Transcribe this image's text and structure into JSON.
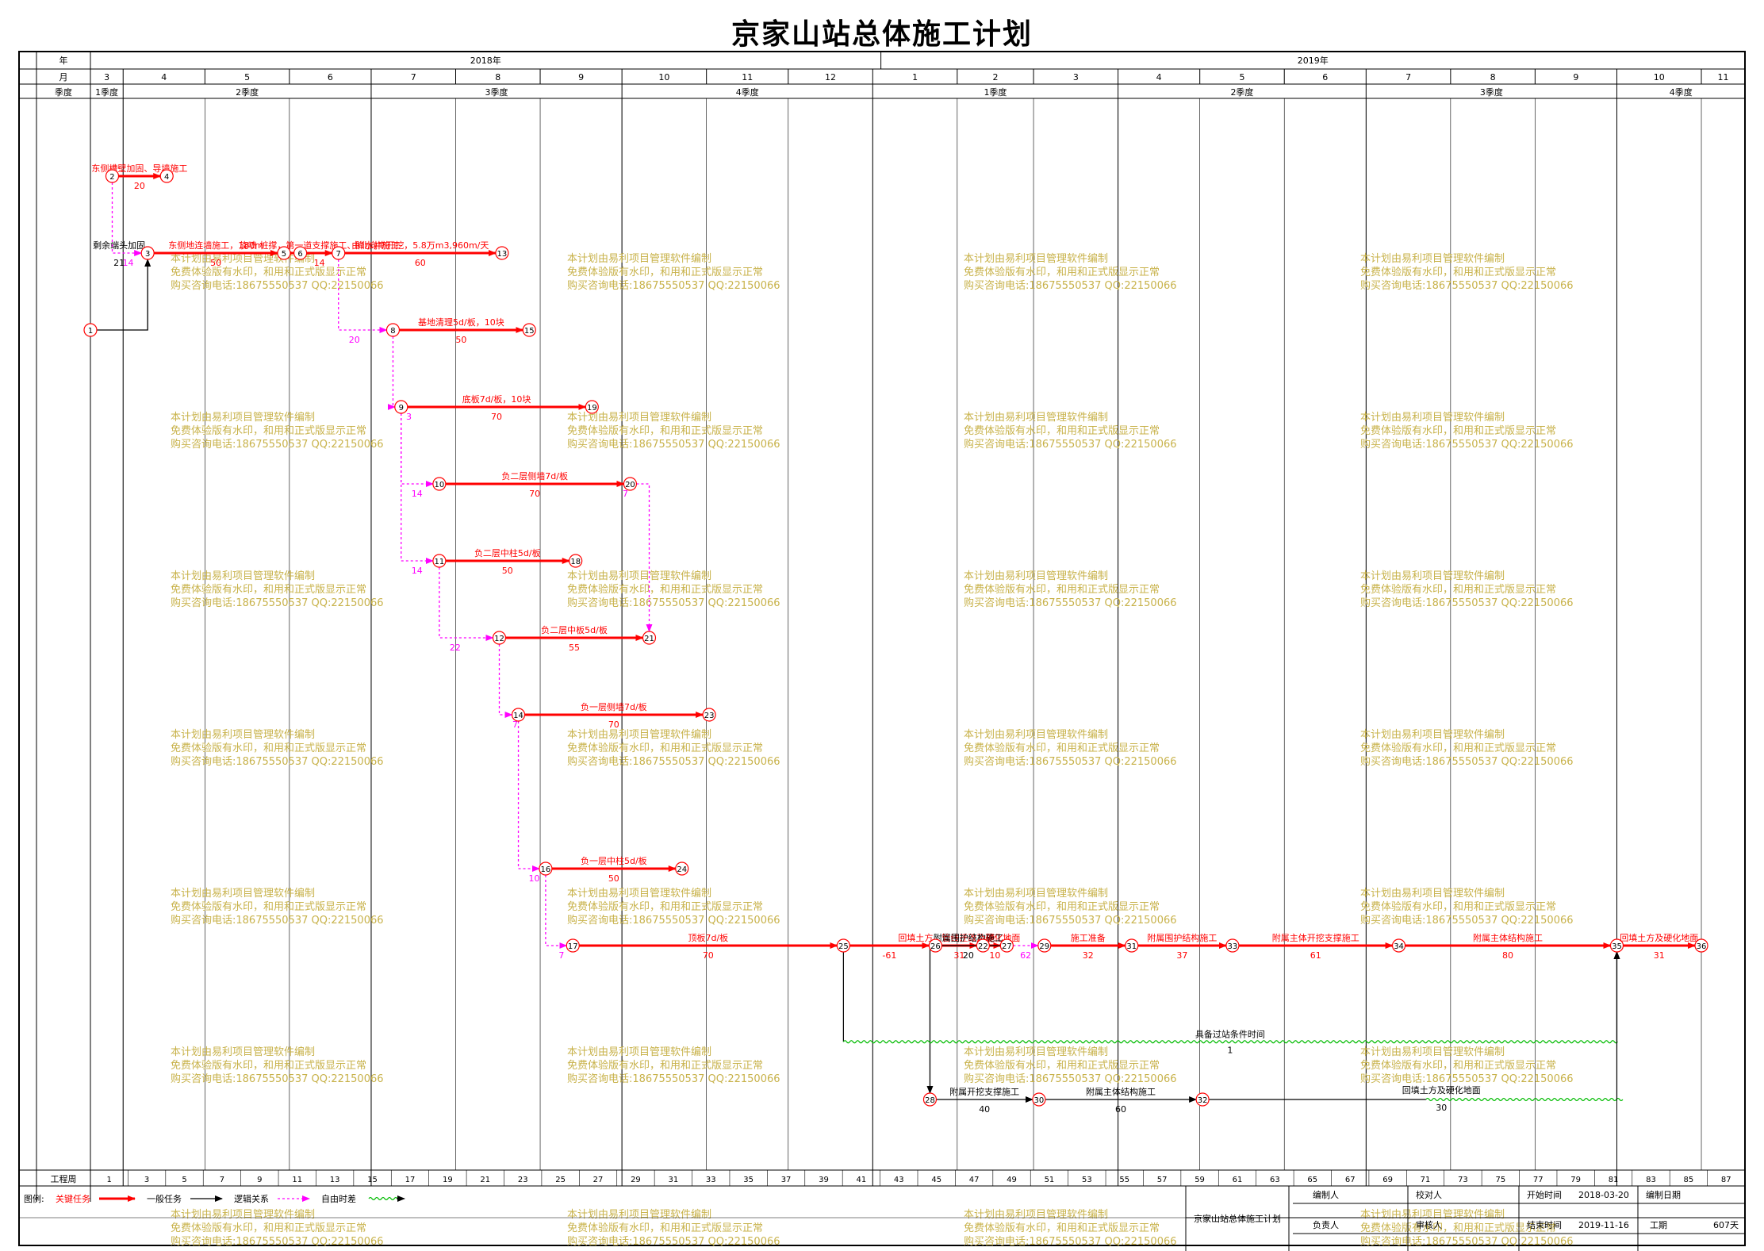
{
  "title": "京家山站总体施工计划",
  "header_labels": {
    "year": "年",
    "month": "月",
    "quarter": "季度",
    "week": "工程周"
  },
  "years": [
    {
      "label": "2018年",
      "start": 0,
      "end": 290
    },
    {
      "label": "2019年",
      "start": 290,
      "end": 607
    }
  ],
  "months": [
    {
      "label": "3",
      "start": 0,
      "end": 12
    },
    {
      "label": "4",
      "start": 12,
      "end": 42
    },
    {
      "label": "5",
      "start": 42,
      "end": 73
    },
    {
      "label": "6",
      "start": 73,
      "end": 103
    },
    {
      "label": "7",
      "start": 103,
      "end": 134
    },
    {
      "label": "8",
      "start": 134,
      "end": 165
    },
    {
      "label": "9",
      "start": 165,
      "end": 195
    },
    {
      "label": "10",
      "start": 195,
      "end": 226
    },
    {
      "label": "11",
      "start": 226,
      "end": 256
    },
    {
      "label": "12",
      "start": 256,
      "end": 287
    },
    {
      "label": "1",
      "start": 287,
      "end": 318
    },
    {
      "label": "2",
      "start": 318,
      "end": 346
    },
    {
      "label": "3",
      "start": 346,
      "end": 377
    },
    {
      "label": "4",
      "start": 377,
      "end": 407
    },
    {
      "label": "5",
      "start": 407,
      "end": 438
    },
    {
      "label": "6",
      "start": 438,
      "end": 468
    },
    {
      "label": "7",
      "start": 468,
      "end": 499
    },
    {
      "label": "8",
      "start": 499,
      "end": 530
    },
    {
      "label": "9",
      "start": 530,
      "end": 560
    },
    {
      "label": "10",
      "start": 560,
      "end": 591
    },
    {
      "label": "11",
      "start": 591,
      "end": 607
    }
  ],
  "quarters": [
    {
      "label": "1季度",
      "start": 0,
      "end": 12
    },
    {
      "label": "2季度",
      "start": 12,
      "end": 103
    },
    {
      "label": "3季度",
      "start": 103,
      "end": 195
    },
    {
      "label": "4季度",
      "start": 195,
      "end": 287
    },
    {
      "label": "1季度",
      "start": 287,
      "end": 377
    },
    {
      "label": "2季度",
      "start": 377,
      "end": 468
    },
    {
      "label": "3季度",
      "start": 468,
      "end": 560
    },
    {
      "label": "4季度",
      "start": 560,
      "end": 607
    }
  ],
  "weeks": [
    "1",
    "3",
    "5",
    "7",
    "9",
    "11",
    "13",
    "15",
    "17",
    "19",
    "21",
    "23",
    "25",
    "27",
    "29",
    "31",
    "33",
    "35",
    "37",
    "39",
    "41",
    "43",
    "45",
    "47",
    "49",
    "51",
    "53",
    "55",
    "57",
    "59",
    "61",
    "63",
    "65",
    "67",
    "69",
    "71",
    "73",
    "75",
    "77",
    "79",
    "81",
    "83",
    "85",
    "87"
  ],
  "nodes": [
    {
      "id": "1",
      "day": 0,
      "row": 4
    },
    {
      "id": "2",
      "day": 8,
      "row": 0
    },
    {
      "id": "3",
      "day": 21,
      "row": 2
    },
    {
      "id": "4",
      "day": 28,
      "row": 0
    },
    {
      "id": "5",
      "day": 71,
      "row": 2
    },
    {
      "id": "6",
      "day": 77,
      "row": 2
    },
    {
      "id": "7",
      "day": 91,
      "row": 2
    },
    {
      "id": "8",
      "day": 111,
      "row": 4
    },
    {
      "id": "9",
      "day": 114,
      "row": 6
    },
    {
      "id": "10",
      "day": 128,
      "row": 8
    },
    {
      "id": "11",
      "day": 128,
      "row": 10
    },
    {
      "id": "12",
      "day": 150,
      "row": 12
    },
    {
      "id": "13",
      "day": 151,
      "row": 2
    },
    {
      "id": "14",
      "day": 157,
      "row": 14
    },
    {
      "id": "15",
      "day": 161,
      "row": 4
    },
    {
      "id": "16",
      "day": 167,
      "row": 18
    },
    {
      "id": "17",
      "day": 177,
      "row": 20
    },
    {
      "id": "18",
      "day": 178,
      "row": 10
    },
    {
      "id": "19",
      "day": 184,
      "row": 6
    },
    {
      "id": "20",
      "day": 198,
      "row": 8
    },
    {
      "id": "21",
      "day": 205,
      "row": 12
    },
    {
      "id": "22",
      "day": 247,
      "row": 20
    },
    {
      "id": "23",
      "day": 227,
      "row": 14
    },
    {
      "id": "24",
      "day": 217,
      "row": 18
    },
    {
      "id": "25",
      "day": 278,
      "row": 20
    },
    {
      "id": "26",
      "day": 278,
      "row": 20
    },
    {
      "id": "27",
      "day": 288,
      "row": 20
    },
    {
      "id": "28",
      "day": 308,
      "row": 24
    },
    {
      "id": "29",
      "day": 350,
      "row": 20
    },
    {
      "id": "30",
      "day": 348,
      "row": 24
    },
    {
      "id": "31",
      "day": 382,
      "row": 20
    },
    {
      "id": "32",
      "day": 408,
      "row": 24
    },
    {
      "id": "33",
      "day": 419,
      "row": 20
    },
    {
      "id": "34",
      "day": 480,
      "row": 20
    },
    {
      "id": "35",
      "day": 560,
      "row": 20
    },
    {
      "id": "36",
      "day": 591,
      "row": 20
    }
  ],
  "tasks": [
    {
      "from": "2",
      "to": "4",
      "name": "东侧槽壁加固、导墙施工",
      "dur": "20",
      "type": "critical"
    },
    {
      "from": "1",
      "to": "3",
      "name": "剩余端头加固",
      "dur": "21",
      "type": "normal"
    },
    {
      "from": "3",
      "to": "5",
      "name": "东侧地连墙施工，180m",
      "dur": "50",
      "type": "critical"
    },
    {
      "from": "5",
      "to": "6",
      "name": "",
      "dur": "",
      "type": "critical"
    },
    {
      "from": "6",
      "to": "7",
      "name": "旋喷 桩撑，第一道支撑施工、降水井施工",
      "dur": "14",
      "type": "critical"
    },
    {
      "from": "7",
      "to": "13",
      "name": "由北向南开挖，5.8万m3,960m/天",
      "dur": "60",
      "type": "critical"
    },
    {
      "from": "8",
      "to": "15",
      "name": "基地清理5d/板，10块",
      "dur": "50",
      "type": "critical"
    },
    {
      "from": "9",
      "to": "19",
      "name": "底板7d/板，10块",
      "dur": "70",
      "type": "critical"
    },
    {
      "from": "10",
      "to": "20",
      "name": "负二层侧墙7d/板",
      "dur": "70",
      "type": "critical"
    },
    {
      "from": "11",
      "to": "18",
      "name": "负二层中柱5d/板",
      "dur": "50",
      "type": "critical"
    },
    {
      "from": "12",
      "to": "21",
      "name": "负二层中板5d/板",
      "dur": "55",
      "type": "critical"
    },
    {
      "from": "14",
      "to": "23",
      "name": "负一层侧墙7d/板",
      "dur": "70",
      "type": "critical"
    },
    {
      "from": "16",
      "to": "24",
      "name": "负一层中柱5d/板",
      "dur": "50",
      "type": "critical"
    },
    {
      "from": "17",
      "to": "25",
      "name": "顶板7d/板",
      "dur": "70",
      "type": "critical"
    },
    {
      "from": "25",
      "to": "26",
      "name": "",
      "dur": "-61",
      "type": "critical"
    },
    {
      "from": "26",
      "to": "22",
      "name": "回填土方、管线迁改及硬化地面",
      "dur": "31",
      "type": "critical"
    },
    {
      "from": "22",
      "to": "27",
      "name": "施工",
      "dur": "10",
      "type": "critical"
    },
    {
      "from": "29",
      "to": "31",
      "name": "施工准备",
      "dur": "32",
      "type": "critical"
    },
    {
      "from": "31",
      "to": "33",
      "name": "附属围护结构施工",
      "dur": "37",
      "type": "critical"
    },
    {
      "from": "33",
      "to": "34",
      "name": "附属主体开挖支撑施工",
      "dur": "61",
      "type": "critical"
    },
    {
      "from": "34",
      "to": "35",
      "name": "附属主体结构施工",
      "dur": "80",
      "type": "critical"
    },
    {
      "from": "35",
      "to": "36",
      "name": "回填土方及硬化地面",
      "dur": "31",
      "type": "critical"
    },
    {
      "from": "27",
      "to": "28",
      "name": "附属围护结构施工",
      "dur": "20",
      "type": "normal"
    },
    {
      "from": "28",
      "to": "30",
      "name": "附属开挖支撑施工",
      "dur": "40",
      "type": "normal"
    },
    {
      "from": "30",
      "to": "32",
      "name": "附属主体结构施工",
      "dur": "60",
      "type": "normal"
    }
  ],
  "free_floats": [
    {
      "label": "14"
    },
    {
      "label": "20"
    },
    {
      "label": "3"
    },
    {
      "label": "14"
    },
    {
      "label": "14"
    },
    {
      "label": "22"
    },
    {
      "label": "7"
    },
    {
      "label": "10"
    },
    {
      "label": "7"
    },
    {
      "label": "7"
    },
    {
      "label": "62"
    }
  ],
  "extra_labels": {
    "condition": "具备过站条件时间",
    "condition_dur": "1",
    "backfill2": "回填土方及硬化地面",
    "backfill2_dur": "30"
  },
  "watermark_lines": [
    "本计划由易利项目管理软件编制",
    "免费体验版有水印，和用和正式版显示正常",
    "购买咨询电话:18675550537 QQ:22150066"
  ],
  "legend": {
    "title": "图例:",
    "critical": "关键任务",
    "normal": "一般任务",
    "logic": "逻辑关系",
    "float": "自由时差"
  },
  "info": {
    "project": "京家山站总体施工计划",
    "author_label": "编制人",
    "author": "",
    "owner_label": "负责人",
    "owner": "",
    "checker_label": "校对人",
    "checker": "",
    "reviewer_label": "审核人",
    "reviewer": "",
    "start_label": "开始时间",
    "start": "2018-03-20",
    "end_label": "结束时间",
    "end": "2019-11-16",
    "date_label": "编制日期",
    "date": "",
    "duration_label": "工期",
    "duration": "607天"
  },
  "colors": {
    "critical": "#ff0000",
    "normal": "#000000",
    "float": "#ff00ff",
    "wave": "#00bb00",
    "watermark": "#c8b24a"
  }
}
